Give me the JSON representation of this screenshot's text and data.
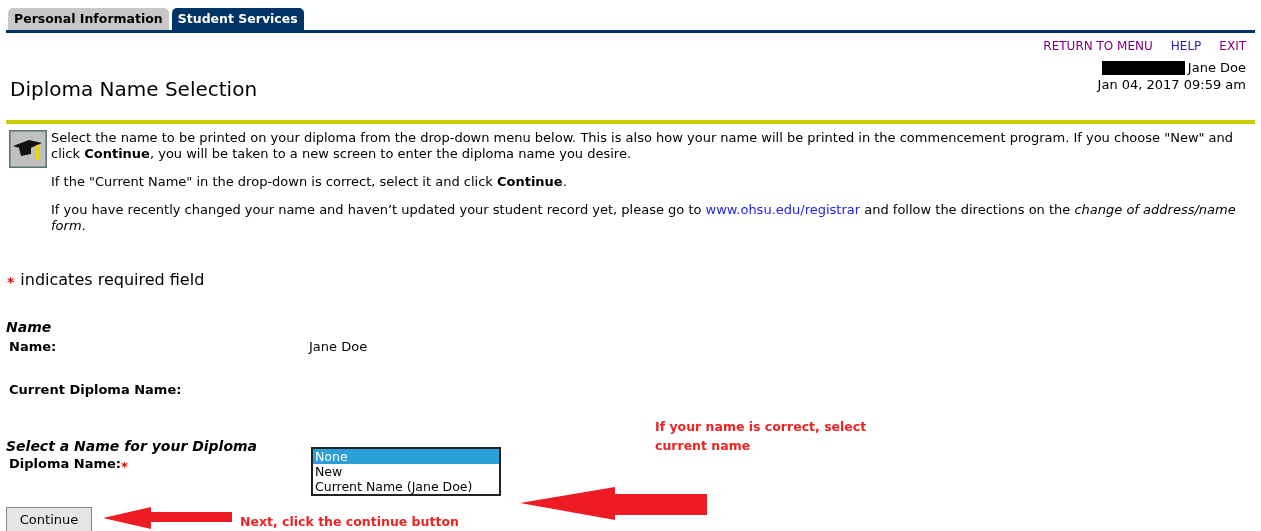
{
  "tabs": [
    {
      "label": "Personal Information",
      "selected": false
    },
    {
      "label": "Student Services",
      "selected": true
    }
  ],
  "nav_links": [
    "RETURN TO MENU",
    "HELP",
    "EXIT"
  ],
  "user": {
    "name": "Jane Doe",
    "date": "Jan 04, 2017 09:59 am"
  },
  "page_title": "Diploma Name Selection",
  "info": {
    "paragraphs": [
      {
        "text": "Select the name to be printed on your diploma from the drop-down menu below. This is also how your name will be printed in the commencement program. If you choose \"New\" and click **Continue**, you will be taken to a new screen to enter the diploma name you desire."
      },
      {
        "text": "If the \"Current Name\" in the drop-down is correct, select it and click **Continue**."
      },
      {
        "text": "If you have recently changed your name and haven’t updated your student record yet, please go to ",
        "link": "www.ohsu.edu/registrar",
        "after": " and follow the directions on the *change of address/name form*."
      }
    ]
  },
  "required_note": {
    "mark": "*",
    "text": "indicates required field"
  },
  "name_section": {
    "heading": "Name",
    "rows": [
      {
        "label": "Name:",
        "value": "Jane Doe"
      },
      {
        "label": "Current Diploma Name:"
      }
    ]
  },
  "diploma_section": {
    "heading": "Select a Name for your Diploma",
    "label": "Diploma Name:",
    "required_mark": "*",
    "options": [
      {
        "label": "None",
        "selected": true
      },
      {
        "label": "New",
        "selected": false
      },
      {
        "label": "Current Name (Jane Doe)",
        "selected": false
      }
    ]
  },
  "continue_button": "Continue",
  "annotations": [
    "If your name is correct, select current name",
    "Next, click the continue button"
  ]
}
